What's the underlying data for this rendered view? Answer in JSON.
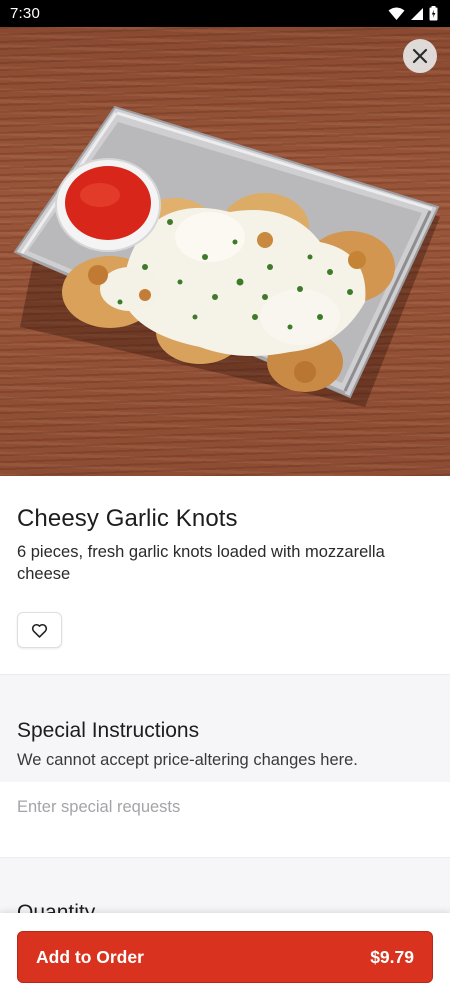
{
  "status_bar": {
    "time": "7:30"
  },
  "item": {
    "title": "Cheesy Garlic Knots",
    "description": "6 pieces, fresh garlic knots loaded with mozzarella cheese"
  },
  "special_instructions": {
    "title": "Special Instructions",
    "subtitle": "We cannot accept price-altering changes here.",
    "placeholder": "Enter special requests"
  },
  "quantity": {
    "title": "Quantity"
  },
  "order_button": {
    "label": "Add to Order",
    "price": "$9.79"
  },
  "colors": {
    "accent": "#d9321e",
    "section_bg": "#f6f6f8"
  },
  "icons": {
    "close": "close-icon",
    "favorite": "heart-outline-icon"
  }
}
